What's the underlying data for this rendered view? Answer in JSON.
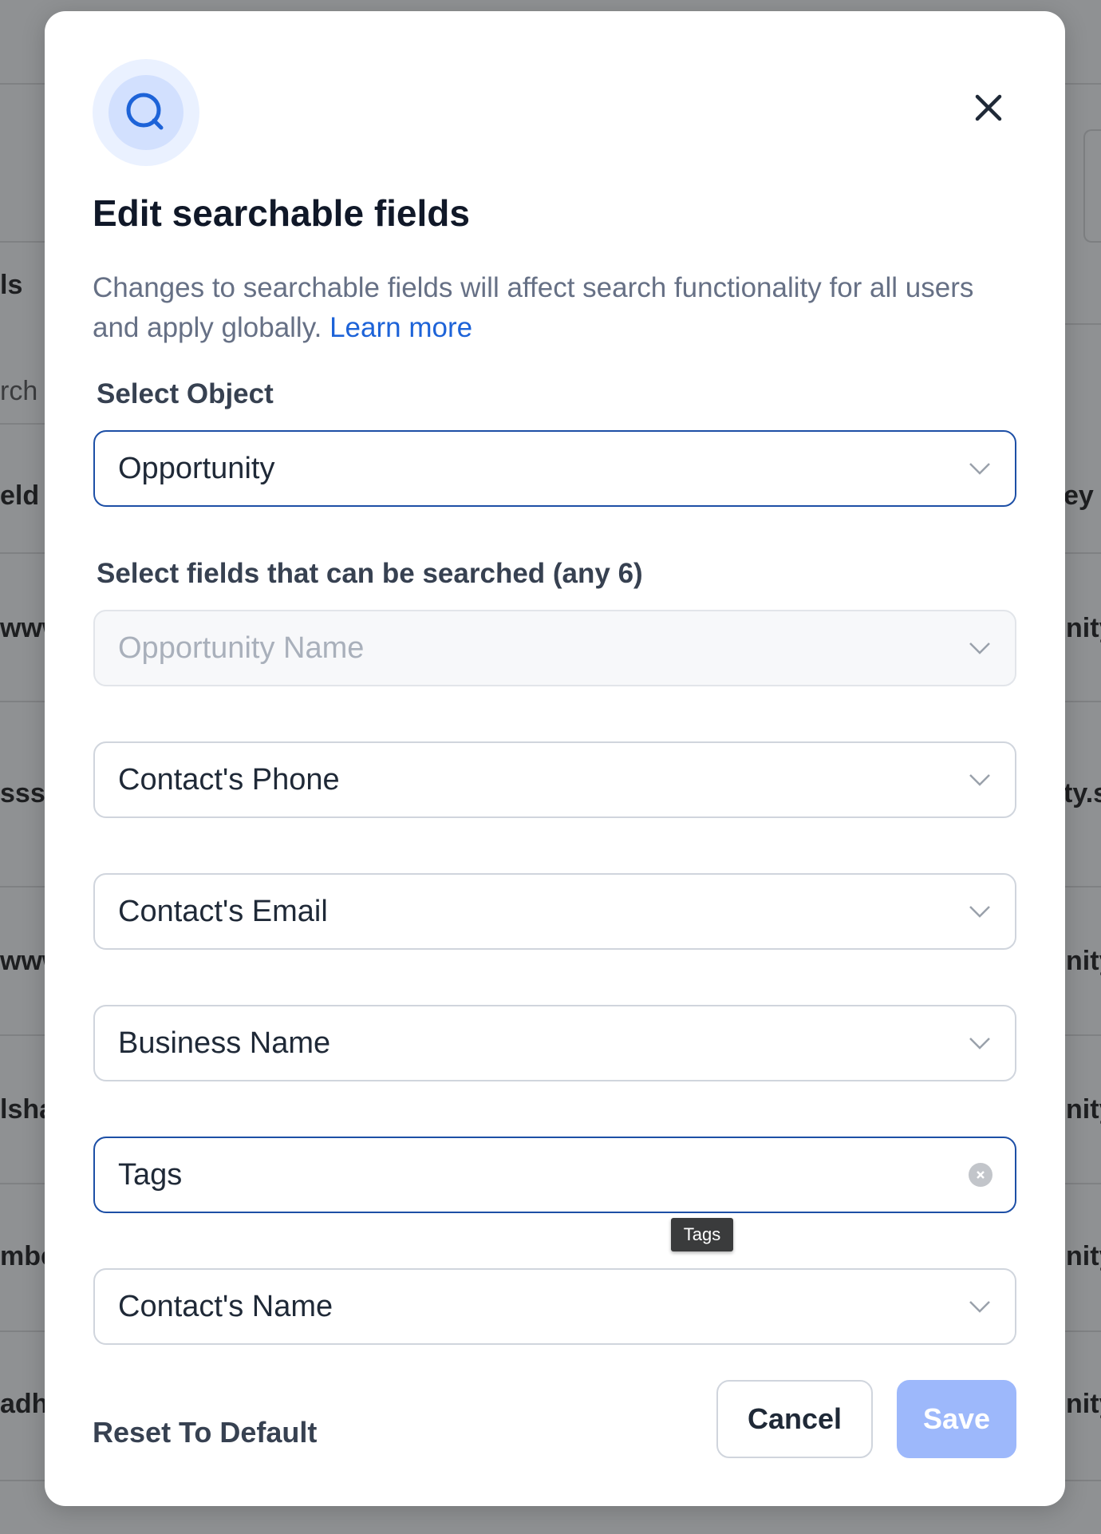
{
  "background": {
    "fragments": [
      "ls",
      "rch",
      "eld",
      "ey",
      "www",
      "nity",
      "ssss",
      "ty.s",
      "www",
      "nity",
      "lsha",
      "nity",
      "mbe",
      "nity",
      "adhu",
      "nity"
    ]
  },
  "modal": {
    "icon": "search-icon",
    "close_icon": "close-icon",
    "title": "Edit searchable fields",
    "description": "Changes to searchable fields will affect search functionality for all users and apply globally.",
    "learn_more": "Learn more",
    "object_label": "Select Object",
    "object_value": "Opportunity",
    "fields_label": "Select fields that can be searched (any 6)",
    "fields": [
      {
        "value": "Opportunity Name",
        "state": "disabled"
      },
      {
        "value": "Contact's Phone",
        "state": "normal"
      },
      {
        "value": "Contact's Email",
        "state": "normal"
      },
      {
        "value": "Business Name",
        "state": "normal"
      },
      {
        "value": "Tags",
        "state": "focused-clearable"
      },
      {
        "value": "Contact's Name",
        "state": "normal"
      }
    ],
    "tooltip": "Tags",
    "reset_label": "Reset To Default",
    "cancel_label": "Cancel",
    "save_label": "Save"
  },
  "colors": {
    "accent": "#1d63d8",
    "focus_border": "#1d4fa6",
    "save_disabled": "#9db8fb",
    "overlay": "#8f9193"
  }
}
